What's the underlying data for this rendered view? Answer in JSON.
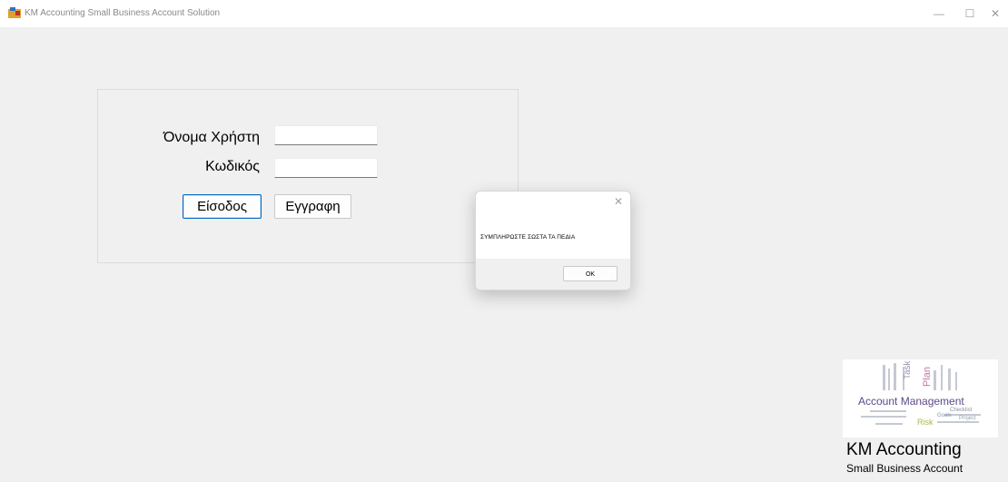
{
  "window": {
    "title": "KM Accounting Small Business Account Solution",
    "controls": {
      "minimize": "—",
      "maximize": "☐",
      "close": "✕"
    }
  },
  "login": {
    "username_label": "Όνομα Χρήστη",
    "password_label": "Κωδικός",
    "username_value": "",
    "password_value": "",
    "login_button": "Είσοδος",
    "register_button": "Εγγραφη"
  },
  "dialog": {
    "message": "ΣΥΜΠΛΗΡΩΣΤΕ ΣΩΣΤΑ ΤΑ ΠΕΔΙΑ",
    "ok_button": "OK",
    "close_glyph": "✕"
  },
  "branding": {
    "logo_word": "Account Management",
    "logo_words_small": [
      "Task",
      "Plan",
      "Checklist",
      "Goals",
      "Risk",
      "Project"
    ],
    "title": "KM Accounting",
    "subtitle": "Small Business Account"
  },
  "colors": {
    "accent": "#0067c0",
    "background": "#f0f0f0",
    "dialog_footer": "#f0f0f0"
  }
}
